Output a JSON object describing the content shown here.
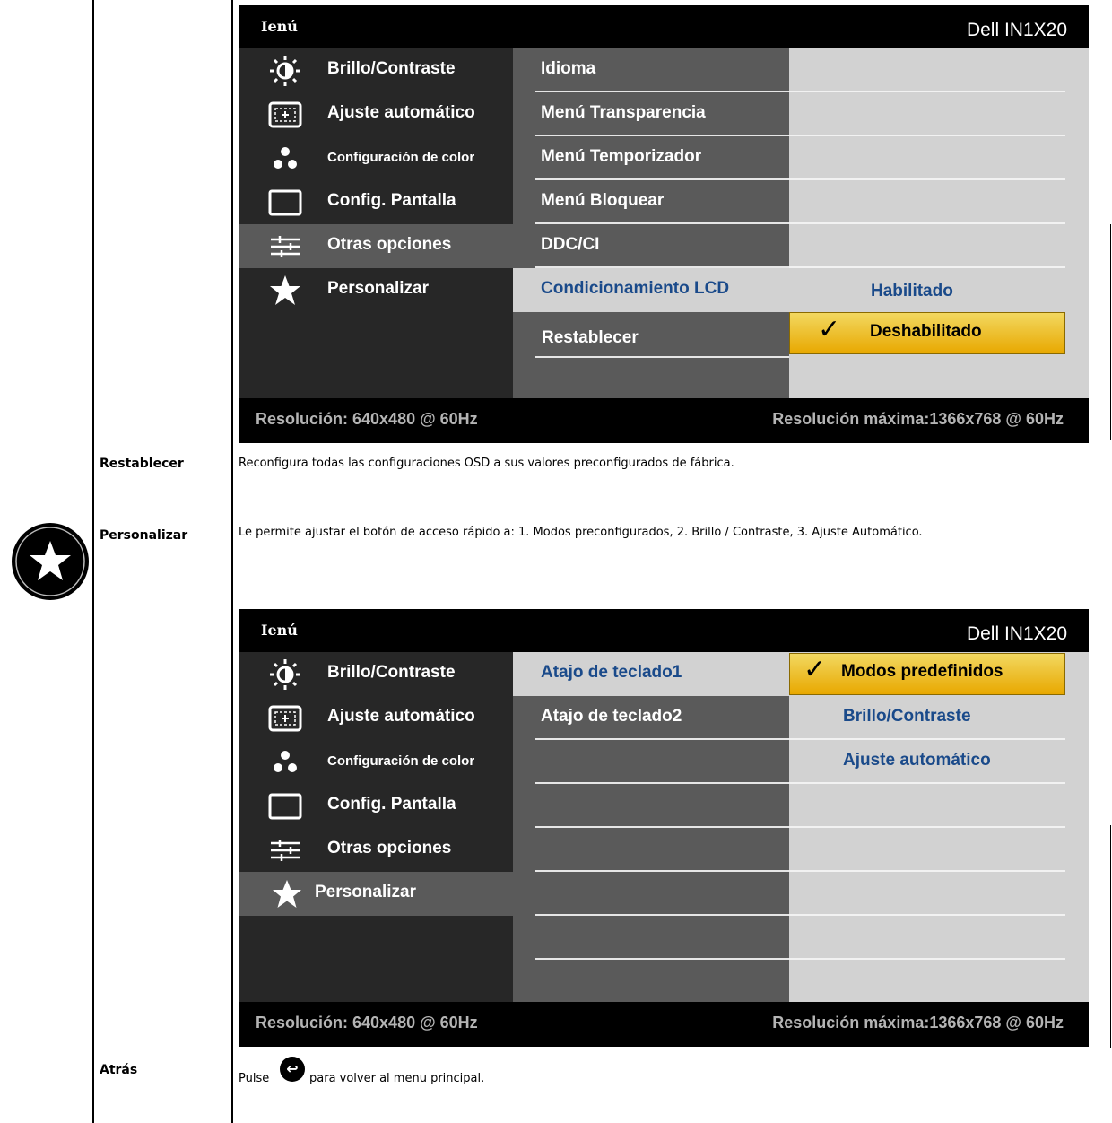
{
  "osd1": {
    "brand": "Ienú",
    "model": "Dell IN1X20",
    "menu": [
      {
        "label": "Brillo/Contraste",
        "icon": "brightness-icon"
      },
      {
        "label": "Ajuste  automático",
        "icon": "auto-adjust-icon"
      },
      {
        "label": "Configuración de color",
        "icon": "color-settings-icon"
      },
      {
        "label": "Config. Pantalla",
        "icon": "display-settings-icon"
      },
      {
        "label": "Otras opciones",
        "icon": "other-settings-icon"
      },
      {
        "label": "Personalizar",
        "icon": "star-icon"
      }
    ],
    "submenu": [
      "Idioma",
      "Menú Transparencia",
      "Menú Temporizador",
      "Menú Bloquear",
      "DDC/CI",
      "Condicionamiento LCD",
      "Restablecer"
    ],
    "options": {
      "enabled": "Habilitado",
      "disabled": "Deshabilitado"
    },
    "resolution": "Resolución:  640x480 @ 60Hz",
    "max_resolution": "Resolución máxima:1366x768 @ 60Hz"
  },
  "osd2": {
    "brand": "Ienú",
    "model": "Dell IN1X20",
    "menu": [
      {
        "label": "Brillo/Contraste",
        "icon": "brightness-icon"
      },
      {
        "label": "Ajuste  automático",
        "icon": "auto-adjust-icon"
      },
      {
        "label": "Configuración de color",
        "icon": "color-settings-icon"
      },
      {
        "label": "Config. Pantalla",
        "icon": "display-settings-icon"
      },
      {
        "label": "Otras opciones",
        "icon": "other-settings-icon"
      },
      {
        "label": "Personalizar",
        "icon": "star-icon"
      }
    ],
    "submenu": [
      "Atajo de teclado1",
      "Atajo de teclado2"
    ],
    "options": [
      "Modos predefinidos",
      "Brillo/Contraste",
      "Ajuste  automático"
    ],
    "resolution": "Resolución:  640x480 @ 60Hz",
    "max_resolution": "Resolución máxima:1366x768 @ 60Hz"
  },
  "rows": {
    "reset": {
      "label": "Restablecer",
      "desc": "Reconfigura todas las configuraciones OSD a sus valores preconfigurados de fábrica."
    },
    "personalize": {
      "label": "Personalizar",
      "desc": "Le permite ajustar el botón de acceso rápido a: 1. Modos preconfigurados, 2. Brillo / Contraste, 3. Ajuste Automático."
    },
    "back": {
      "label": "Atrás",
      "desc_before": "Pulse",
      "desc_after": "para volver al menu principal."
    }
  }
}
